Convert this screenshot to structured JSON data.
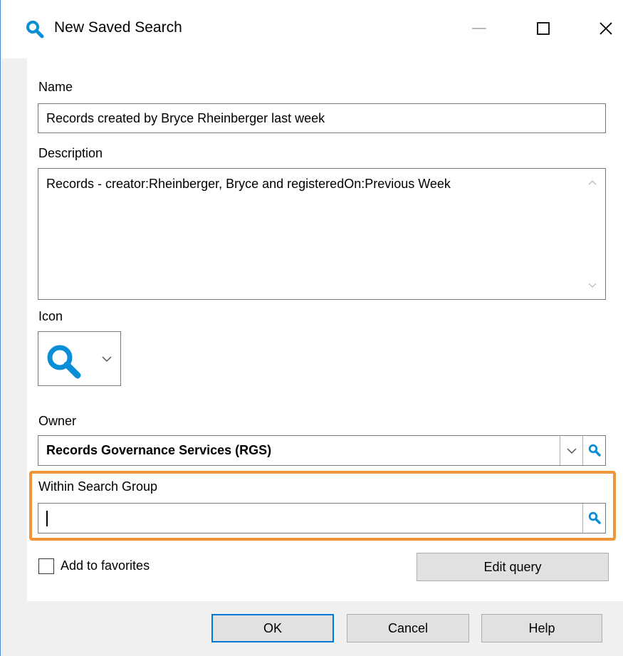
{
  "window": {
    "title": "New Saved Search"
  },
  "form": {
    "name_label": "Name",
    "name_value": "Records created by Bryce Rheinberger last week",
    "description_label": "Description",
    "description_value": "Records - creator:Rheinberger, Bryce and registeredOn:Previous Week",
    "icon_label": "Icon",
    "icon_selected": "search-icon",
    "owner_label": "Owner",
    "owner_value": "Records Governance Services (RGS)",
    "within_group_label": "Within Search Group",
    "within_group_value": "",
    "add_favorites_label": "Add to favorites",
    "add_favorites_checked": false,
    "edit_query_label": "Edit query"
  },
  "buttons": {
    "ok": "OK",
    "cancel": "Cancel",
    "help": "Help"
  },
  "colors": {
    "accent": "#0b8ed8",
    "highlight": "#f0963a",
    "default_button_border": "#0078d7"
  }
}
